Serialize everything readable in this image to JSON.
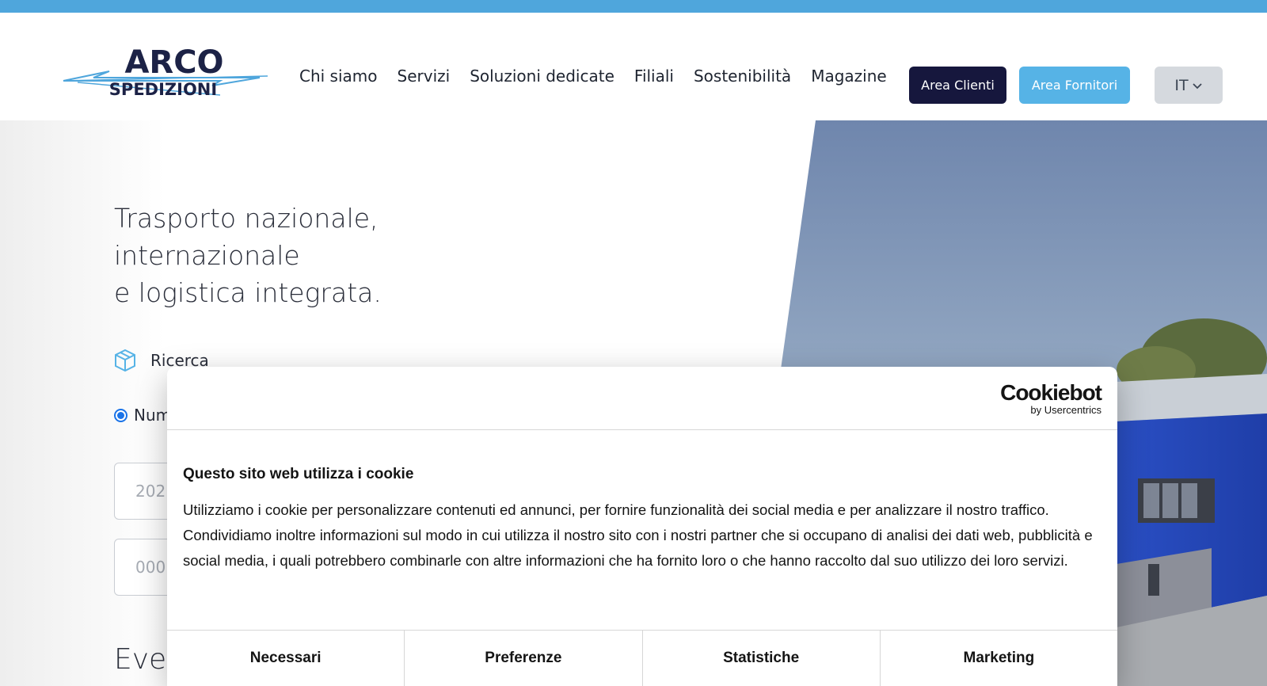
{
  "brand": {
    "name_top": "ARCO",
    "name_bottom": "SPEDIZIONI"
  },
  "nav": {
    "items": [
      {
        "label": "Chi siamo"
      },
      {
        "label": "Servizi"
      },
      {
        "label": "Soluzioni dedicate"
      },
      {
        "label": "Filiali"
      },
      {
        "label": "Sostenibilità"
      },
      {
        "label": "Magazine"
      }
    ],
    "area_clienti": "Area Clienti",
    "area_fornitori": "Area Fornitori",
    "language": "IT"
  },
  "hero": {
    "title_lines": [
      "Trasporto nazionale,",
      "internazionale",
      "e logistica integrata."
    ],
    "search_label": "Ricerca",
    "radio_label": "Num",
    "field1_placeholder": "202",
    "field2_placeholder": "000",
    "events_heading": "Even"
  },
  "cookie_banner": {
    "brand": "Cookiebot",
    "brand_sub": "by Usercentrics",
    "title": "Questo sito web utilizza i cookie",
    "body": "Utilizziamo i cookie per personalizzare contenuti ed annunci, per fornire funzionalità dei social media e per analizzare il nostro traffico. Condividiamo inoltre informazioni sul modo in cui utilizza il nostro sito con i nostri partner che si occupano di analisi dei dati web, pubblicità e social media, i quali potrebbero combinarle con altre informazioni che ha fornito loro o che hanno raccolto dal suo utilizzo dei loro servizi.",
    "tabs": [
      {
        "label": "Necessari"
      },
      {
        "label": "Preferenze"
      },
      {
        "label": "Statistiche"
      },
      {
        "label": "Marketing"
      }
    ]
  },
  "colors": {
    "topbar": "#4fa6dc",
    "area_clienti_bg": "#16173d",
    "area_fornitori_bg": "#56b3e6",
    "language_bg": "#d5d9de"
  }
}
